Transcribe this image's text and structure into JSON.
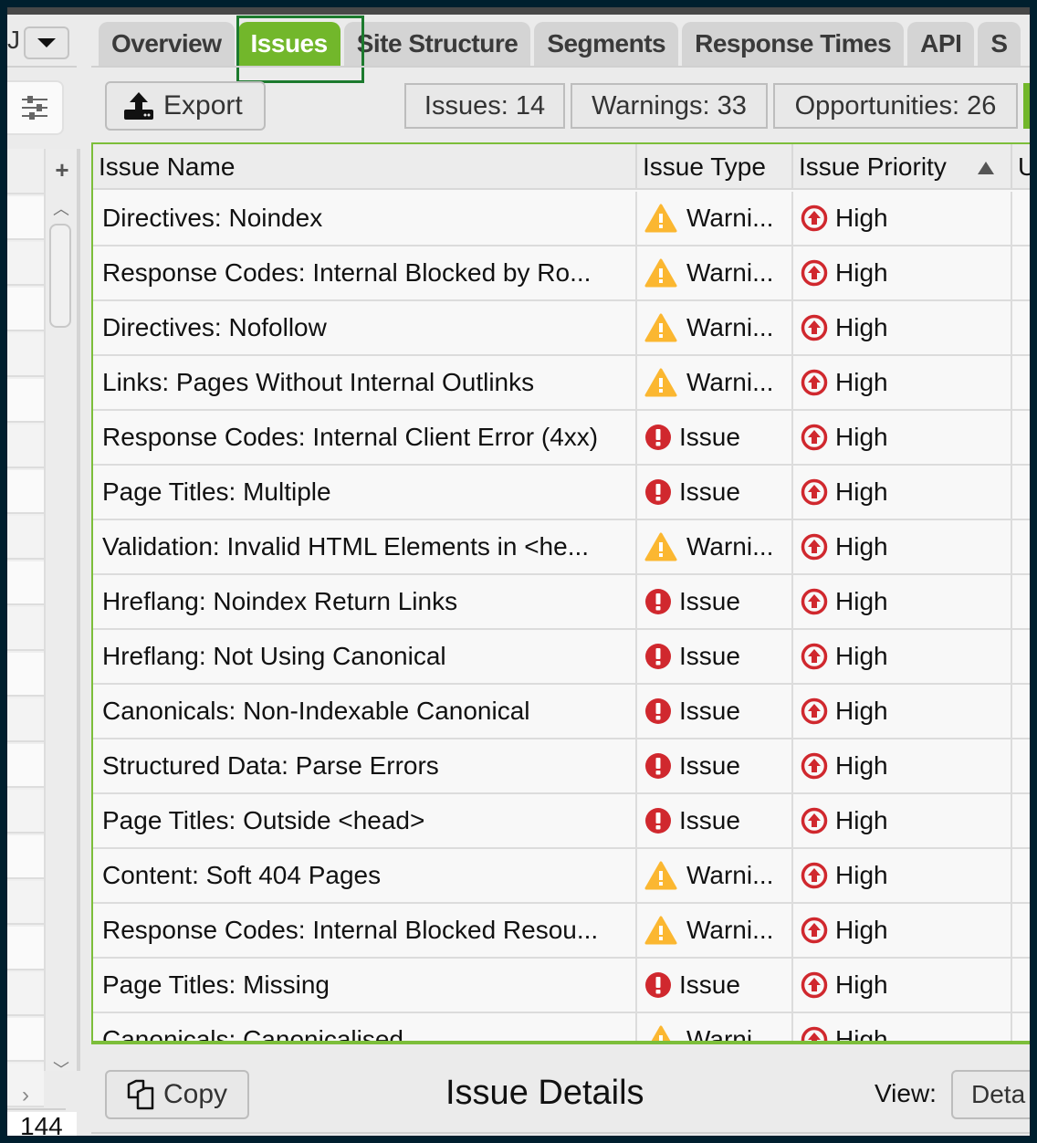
{
  "left_panel": {
    "truncated_label": "J",
    "row_count": "144"
  },
  "tabs": [
    {
      "label": "Overview",
      "active": false
    },
    {
      "label": "Issues",
      "active": true
    },
    {
      "label": "Site Structure",
      "active": false
    },
    {
      "label": "Segments",
      "active": false
    },
    {
      "label": "Response Times",
      "active": false
    },
    {
      "label": "API",
      "active": false
    },
    {
      "label": "S",
      "active": false
    }
  ],
  "toolbar": {
    "export_label": "Export",
    "issues_count": "Issues: 14",
    "warnings_count": "Warnings: 33",
    "opportunities_count": "Opportunities: 26"
  },
  "table": {
    "columns": [
      "Issue Name",
      "Issue Type",
      "Issue Priority",
      "U"
    ],
    "sort_column": "Issue Priority",
    "sort_direction": "ascending",
    "rows": [
      {
        "name": "Directives: Noindex",
        "type": "Warni...",
        "type_icon": "warning",
        "priority": "High"
      },
      {
        "name": "Response Codes: Internal Blocked by Ro...",
        "type": "Warni...",
        "type_icon": "warning",
        "priority": "High"
      },
      {
        "name": "Directives: Nofollow",
        "type": "Warni...",
        "type_icon": "warning",
        "priority": "High"
      },
      {
        "name": "Links: Pages Without Internal Outlinks",
        "type": "Warni...",
        "type_icon": "warning",
        "priority": "High"
      },
      {
        "name": "Response Codes: Internal Client Error (4xx)",
        "type": "Issue",
        "type_icon": "issue",
        "priority": "High"
      },
      {
        "name": "Page Titles: Multiple",
        "type": "Issue",
        "type_icon": "issue",
        "priority": "High"
      },
      {
        "name": "Validation: Invalid HTML Elements in <he...",
        "type": "Warni...",
        "type_icon": "warning",
        "priority": "High"
      },
      {
        "name": "Hreflang: Noindex Return Links",
        "type": "Issue",
        "type_icon": "issue",
        "priority": "High"
      },
      {
        "name": "Hreflang: Not Using Canonical",
        "type": "Issue",
        "type_icon": "issue",
        "priority": "High"
      },
      {
        "name": "Canonicals: Non-Indexable Canonical",
        "type": "Issue",
        "type_icon": "issue",
        "priority": "High"
      },
      {
        "name": "Structured Data: Parse Errors",
        "type": "Issue",
        "type_icon": "issue",
        "priority": "High"
      },
      {
        "name": "Page Titles: Outside <head>",
        "type": "Issue",
        "type_icon": "issue",
        "priority": "High"
      },
      {
        "name": "Content: Soft 404 Pages",
        "type": "Warni...",
        "type_icon": "warning",
        "priority": "High"
      },
      {
        "name": "Response Codes: Internal Blocked Resou...",
        "type": "Warni...",
        "type_icon": "warning",
        "priority": "High"
      },
      {
        "name": "Page Titles: Missing",
        "type": "Issue",
        "type_icon": "issue",
        "priority": "High"
      },
      {
        "name": "Canonicals: Canonicalised",
        "type": "Warni...",
        "type_icon": "warning",
        "priority": "High"
      }
    ]
  },
  "bottom": {
    "copy_label": "Copy",
    "details_title": "Issue Details",
    "view_label": "View:",
    "view_value": "Deta"
  },
  "colors": {
    "accent_green": "#72b72b",
    "warning_yellow": "#fbb731",
    "issue_red": "#d0282e",
    "focus_green": "#1c7a2e"
  }
}
